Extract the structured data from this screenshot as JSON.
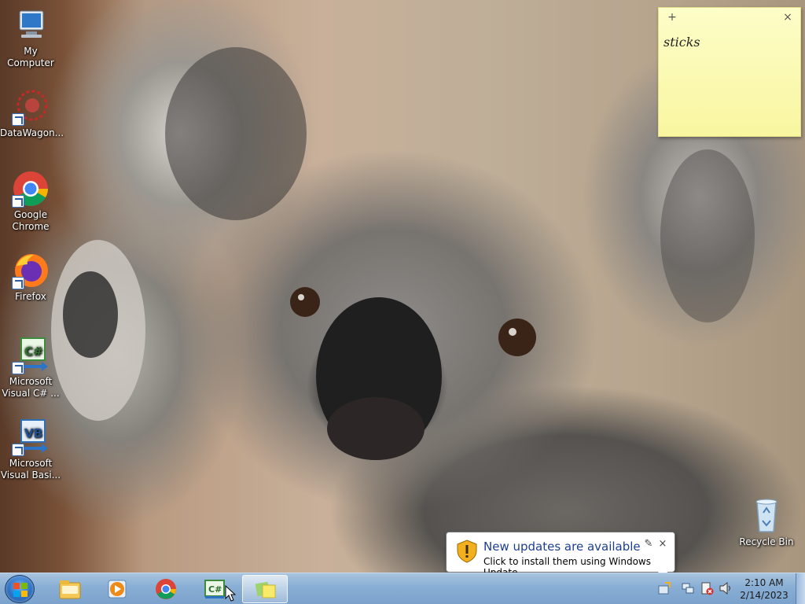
{
  "desktop": {
    "icons": [
      {
        "label": "My Computer",
        "icon": "computer-icon"
      },
      {
        "label": "DataWagon...",
        "icon": "datawagon-icon"
      },
      {
        "label": "Google Chrome",
        "icon": "chrome-icon"
      },
      {
        "label": "Firefox",
        "icon": "firefox-icon"
      },
      {
        "label": "Microsoft Visual C# ...",
        "icon": "visual-csharp-icon"
      },
      {
        "label": "Microsoft Visual Basi...",
        "icon": "visual-basic-icon"
      }
    ],
    "recycle_bin": {
      "label": "Recycle Bin",
      "icon": "recycle-bin-icon"
    }
  },
  "sticky_note": {
    "add_symbol": "+",
    "close_symbol": "×",
    "text": "sticks",
    "color": "#f9f6a0"
  },
  "notification": {
    "title": "New updates are available",
    "body": "Click to install them using Windows Update.",
    "icon": "shield-warning-icon",
    "close_symbol": "×"
  },
  "taskbar": {
    "pinned": [
      "explorer-icon",
      "media-player-icon",
      "chrome-icon",
      "visual-csharp-icon",
      "sticky-notes-icon"
    ],
    "active": "sticky-notes-icon",
    "clock": {
      "time": "2:10 AM",
      "date": "2/14/2023"
    },
    "tray": [
      "update-tray-icon",
      "network-icon",
      "action-center-icon",
      "volume-icon"
    ]
  }
}
